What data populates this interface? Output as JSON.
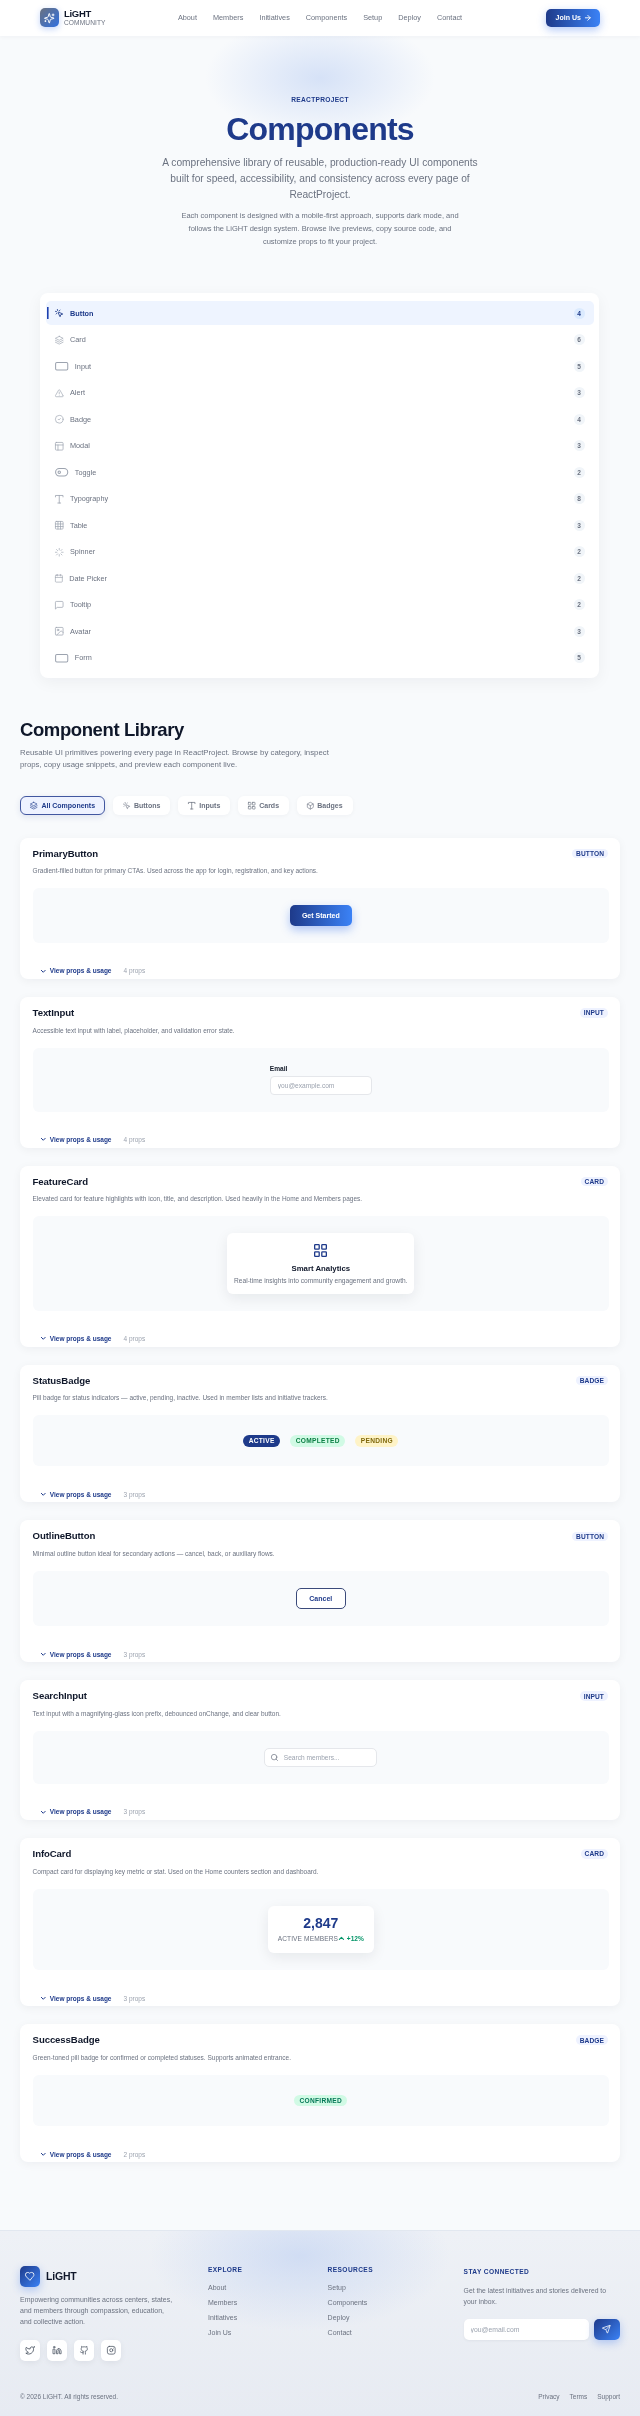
{
  "header": {
    "brand": "LiGHT",
    "tagline": "COMMUNITY",
    "nav": [
      "About",
      "Members",
      "Initiatives",
      "Components",
      "Setup",
      "Deploy",
      "Contact"
    ],
    "cta": "Join Us"
  },
  "hero": {
    "eyebrow": "REACTPROJECT",
    "title": "Components",
    "lead": "A comprehensive library of reusable, production-ready UI components built for speed, accessibility, and consistency across every page of ReactProject.",
    "body": "Each component is designed with a mobile-first approach, supports dark mode, and follows the LiGHT design system. Browse live previews, copy source code, and customize props to fit your project."
  },
  "component_list": {
    "items": [
      {
        "label": "Button",
        "count": "4",
        "selected": true
      },
      {
        "label": "Card",
        "count": "6",
        "selected": false
      },
      {
        "label": "Input",
        "count": "5",
        "selected": false
      },
      {
        "label": "Alert",
        "count": "3",
        "selected": false
      },
      {
        "label": "Badge",
        "count": "4",
        "selected": false
      },
      {
        "label": "Modal",
        "count": "3",
        "selected": false
      },
      {
        "label": "Toggle",
        "count": "2",
        "selected": false
      },
      {
        "label": "Typography",
        "count": "8",
        "selected": false
      },
      {
        "label": "Table",
        "count": "3",
        "selected": false
      },
      {
        "label": "Spinner",
        "count": "2",
        "selected": false
      },
      {
        "label": "Date Picker",
        "count": "2",
        "selected": false
      },
      {
        "label": "Tooltip",
        "count": "2",
        "selected": false
      },
      {
        "label": "Avatar",
        "count": "3",
        "selected": false
      },
      {
        "label": "Form",
        "count": "5",
        "selected": false
      }
    ]
  },
  "library": {
    "title": "Component Library",
    "description": "Reusable UI primitives powering every page in ReactProject. Browse by category, inspect props, copy usage snippets, and preview each component live.",
    "filters": [
      {
        "label": "All Components",
        "selected": true
      },
      {
        "label": "Buttons",
        "selected": false
      },
      {
        "label": "Inputs",
        "selected": false
      },
      {
        "label": "Cards",
        "selected": false
      },
      {
        "label": "Badges",
        "selected": false
      }
    ],
    "components": [
      {
        "name": "PrimaryButton",
        "category": "BUTTON",
        "description": "Gradient-filled button for primary CTAs. Used across the app for login, registration, and key actions.",
        "kind": "primary_button",
        "preview": {
          "label": "Get Started"
        },
        "toggle": {
          "label": "View props & usage",
          "expanded": false
        },
        "props": "4 props"
      },
      {
        "name": "TextInput",
        "category": "INPUT",
        "description": "Accessible text input with label, placeholder, and validation error state.",
        "kind": "text_input",
        "preview": {
          "label": "Email",
          "placeholder": "you@example.com"
        },
        "toggle": {
          "label": "View props & usage",
          "expanded": false
        },
        "props": "4 props"
      },
      {
        "name": "FeatureCard",
        "category": "CARD",
        "description": "Elevated card for feature highlights with icon, title, and description. Used heavily in the Home and Members pages.",
        "kind": "feature_card",
        "preview": {
          "title": "Smart Analytics",
          "text": "Real-time insights into community engagement and growth."
        },
        "toggle": {
          "label": "View props & usage",
          "expanded": false
        },
        "props": "4 props"
      },
      {
        "name": "StatusBadge",
        "category": "BADGE",
        "description": "Pill badge for status indicators — active, pending, inactive. Used in member lists and initiative trackers.",
        "kind": "status_badges",
        "preview": {
          "badges": [
            {
              "label": "ACTIVE",
              "color": "#1e3a8a"
            },
            {
              "label": "COMPLETED",
              "color": "#d1fae5"
            },
            {
              "label": "PENDING",
              "color": "#fef3c7"
            }
          ]
        },
        "toggle": {
          "label": "View props & usage",
          "expanded": false
        },
        "props": "3 props"
      },
      {
        "name": "OutlineButton",
        "category": "BUTTON",
        "description": "Minimal outline button ideal for secondary actions — cancel, back, or auxiliary flows.",
        "kind": "outline_button",
        "preview": {
          "label": "Cancel"
        },
        "toggle": {
          "label": "View props & usage",
          "expanded": false
        },
        "props": "3 props"
      },
      {
        "name": "SearchInput",
        "category": "INPUT",
        "description": "Text input with a magnifying-glass icon prefix, debounced onChange, and clear button.",
        "kind": "search_input",
        "preview": {
          "placeholder": "Search members..."
        },
        "toggle": {
          "label": "View props & usage",
          "expanded": false
        },
        "props": "3 props"
      },
      {
        "name": "InfoCard",
        "category": "CARD",
        "description": "Compact card for displaying key metric or stat. Used on the Home counters section and dashboard.",
        "kind": "stat_card",
        "preview": {
          "value": "2,847",
          "label": "ACTIVE MEMBERS",
          "trend": "+12%"
        },
        "toggle": {
          "label": "View props & usage",
          "expanded": false
        },
        "props": "3 props"
      },
      {
        "name": "SuccessBadge",
        "category": "BADGE",
        "description": "Green-toned pill badge for confirmed or completed statuses. Supports animated entrance.",
        "kind": "success_badge",
        "preview": {
          "label": "CONFIRMED"
        },
        "toggle": {
          "label": "View props & usage",
          "expanded": false
        },
        "props": "2 props"
      }
    ]
  },
  "footer": {
    "brand": "LiGHT",
    "tagline": "Empowering communities across centers, states, and members through compassion, education, and collective action.",
    "columns": [
      {
        "title": "EXPLORE",
        "links": [
          "About",
          "Members",
          "Initiatives",
          "Join Us"
        ]
      },
      {
        "title": "RESOURCES",
        "links": [
          "Setup",
          "Components",
          "Deploy",
          "Contact"
        ]
      }
    ],
    "newsletter": {
      "title": "STAY CONNECTED",
      "text": "Get the latest initiatives and stories delivered to your inbox.",
      "placeholder": "you@email.com"
    },
    "copyright": "© 2026 LiGHT. All rights reserved.",
    "legal_links": [
      "Privacy",
      "Terms",
      "Support"
    ]
  }
}
